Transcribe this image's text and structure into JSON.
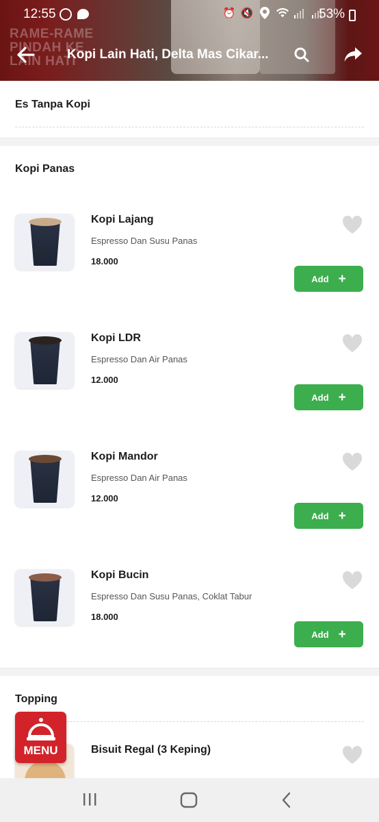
{
  "status_bar": {
    "time": "12:55",
    "battery": "53%"
  },
  "header": {
    "banner_text": "RAME-RAME PINDAH KE LAIN HATI",
    "title": "Kopi Lain Hati, Delta Mas Cikar..."
  },
  "sections": {
    "es_tanpa_kopi": "Es Tanpa Kopi",
    "kopi_panas": "Kopi Panas",
    "topping": "Topping"
  },
  "items": [
    {
      "name": "Kopi Lajang",
      "desc": "Espresso Dan Susu Panas",
      "price": "18.000",
      "add_label": "Add",
      "foam_color": "#c9a98c"
    },
    {
      "name": "Kopi LDR",
      "desc": "Espresso Dan Air Panas",
      "price": "12.000",
      "add_label": "Add",
      "foam_color": "#2a2320"
    },
    {
      "name": "Kopi Mandor",
      "desc": "Espresso Dan Air Panas",
      "price": "12.000",
      "add_label": "Add",
      "foam_color": "#6b4a33"
    },
    {
      "name": "Kopi Bucin",
      "desc": "Espresso Dan Susu Panas, Coklat Tabur",
      "price": "18.000",
      "add_label": "Add",
      "foam_color": "#8c5d48"
    }
  ],
  "topping_item": {
    "name": "Bisuit Regal (3 Keping)"
  },
  "menu_fab": {
    "label": "MENU"
  },
  "colors": {
    "accent_green": "#3cae4e",
    "menu_red": "#d2232a",
    "header_maroon": "#6b1414"
  }
}
